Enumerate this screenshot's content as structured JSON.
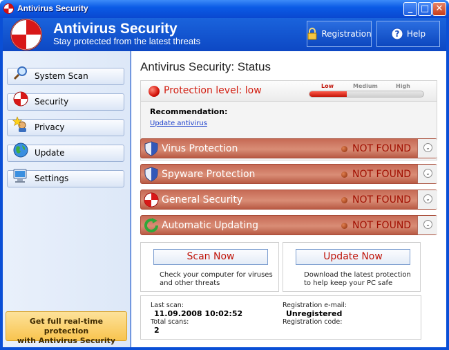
{
  "window": {
    "title": "Antivirus Security",
    "controls": [
      "minimize-icon",
      "maximize-icon",
      "close-icon"
    ]
  },
  "header": {
    "title": "Antivirus Security",
    "subtitle": "Stay protected from the latest threats",
    "registration_label": "Registration",
    "help_label": "Help",
    "icons": {
      "registration": "lock-icon",
      "help": "help-icon",
      "logo": "shield-cross-logo"
    }
  },
  "sidebar": {
    "items": [
      {
        "label": "System Scan",
        "icon": "magnifier-icon"
      },
      {
        "label": "Security",
        "icon": "shield-cross-icon"
      },
      {
        "label": "Privacy",
        "icon": "star-user-icon"
      },
      {
        "label": "Update",
        "icon": "globe-icon"
      },
      {
        "label": "Settings",
        "icon": "computer-icon"
      }
    ],
    "promo_line1": "Get full real-time protection",
    "promo_line2": "with Antivirus Security"
  },
  "main": {
    "status_title": "Antivirus Security: Status",
    "protection": {
      "text": "Protection level: low",
      "levels": [
        "Low",
        "Medium",
        "High"
      ],
      "current_level": "Low",
      "level_fraction": 0.33
    },
    "recommendation_label": "Recommendation:",
    "recommendation_link": "Update antivirus",
    "threats": [
      {
        "name": "Virus Protection",
        "status": "NOT FOUND",
        "icon": "shield-icon"
      },
      {
        "name": "Spyware Protection",
        "status": "NOT FOUND",
        "icon": "shield-icon"
      },
      {
        "name": "General Security",
        "status": "NOT FOUND",
        "icon": "shield-cross-icon"
      },
      {
        "name": "Automatic Updating",
        "status": "NOT FOUND",
        "icon": "refresh-icon"
      }
    ],
    "scan_card": {
      "button": "Scan Now",
      "line1": "Check your computer for viruses",
      "line2": "and other threats"
    },
    "update_card": {
      "button": "Update Now",
      "line1": "Download the latest protection",
      "line2": "to help keep your PC safe"
    },
    "info": {
      "last_scan_label": "Last scan:",
      "last_scan_value": "11.09.2008 10:02:52",
      "total_scans_label": "Total scans:",
      "total_scans_value": "2",
      "reg_email_label": "Registration e-mail:",
      "reg_email_value": "Unregistered",
      "reg_code_label": "Registration code:"
    }
  },
  "colors": {
    "titlebar": "#0a4fd6",
    "alert_red": "#d21d10",
    "threat_bar": "#c66a55",
    "link": "#1a3ecc"
  }
}
